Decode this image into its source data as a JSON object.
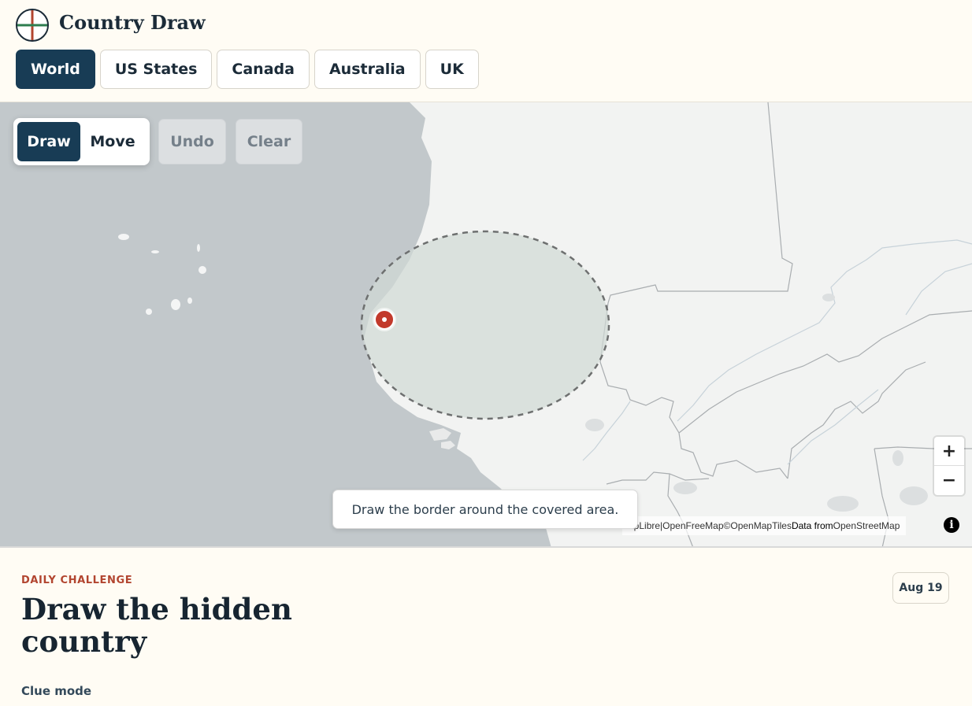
{
  "app": {
    "title": "Country Draw"
  },
  "tabs": [
    {
      "label": "World",
      "active": true
    },
    {
      "label": "US States",
      "active": false
    },
    {
      "label": "Canada",
      "active": false
    },
    {
      "label": "Australia",
      "active": false
    },
    {
      "label": "UK",
      "active": false
    }
  ],
  "map_controls": {
    "draw_label": "Draw",
    "move_label": "Move",
    "undo_label": "Undo",
    "clear_label": "Clear",
    "active_mode": "Draw",
    "zoom_in_label": "+",
    "zoom_out_label": "−"
  },
  "hint": {
    "text": "Draw the border around the covered area."
  },
  "attribution": {
    "maplibre": "apLibre",
    "separator": " | ",
    "openfreemap": "OpenFreeMap",
    "copyright": " © ",
    "openmaptiles": "OpenMapTiles",
    "data_from": " Data from ",
    "openstreetmap": "OpenStreetMap",
    "info_icon": "i"
  },
  "challenge": {
    "kicker": "DAILY CHALLENGE",
    "headline": "Draw the hidden country",
    "date": "Aug 19",
    "clue_mode_label": "Clue mode"
  },
  "colors": {
    "primary": "#183c55",
    "accent": "#b2452f",
    "background": "#fffcf4",
    "ocean": "#c2c8cb",
    "land": "#f2f3f2",
    "marker": "#c23a2c"
  },
  "icons": {
    "logo": "globe-cross-icon",
    "info": "info-icon",
    "marker": "map-pin-marker"
  }
}
